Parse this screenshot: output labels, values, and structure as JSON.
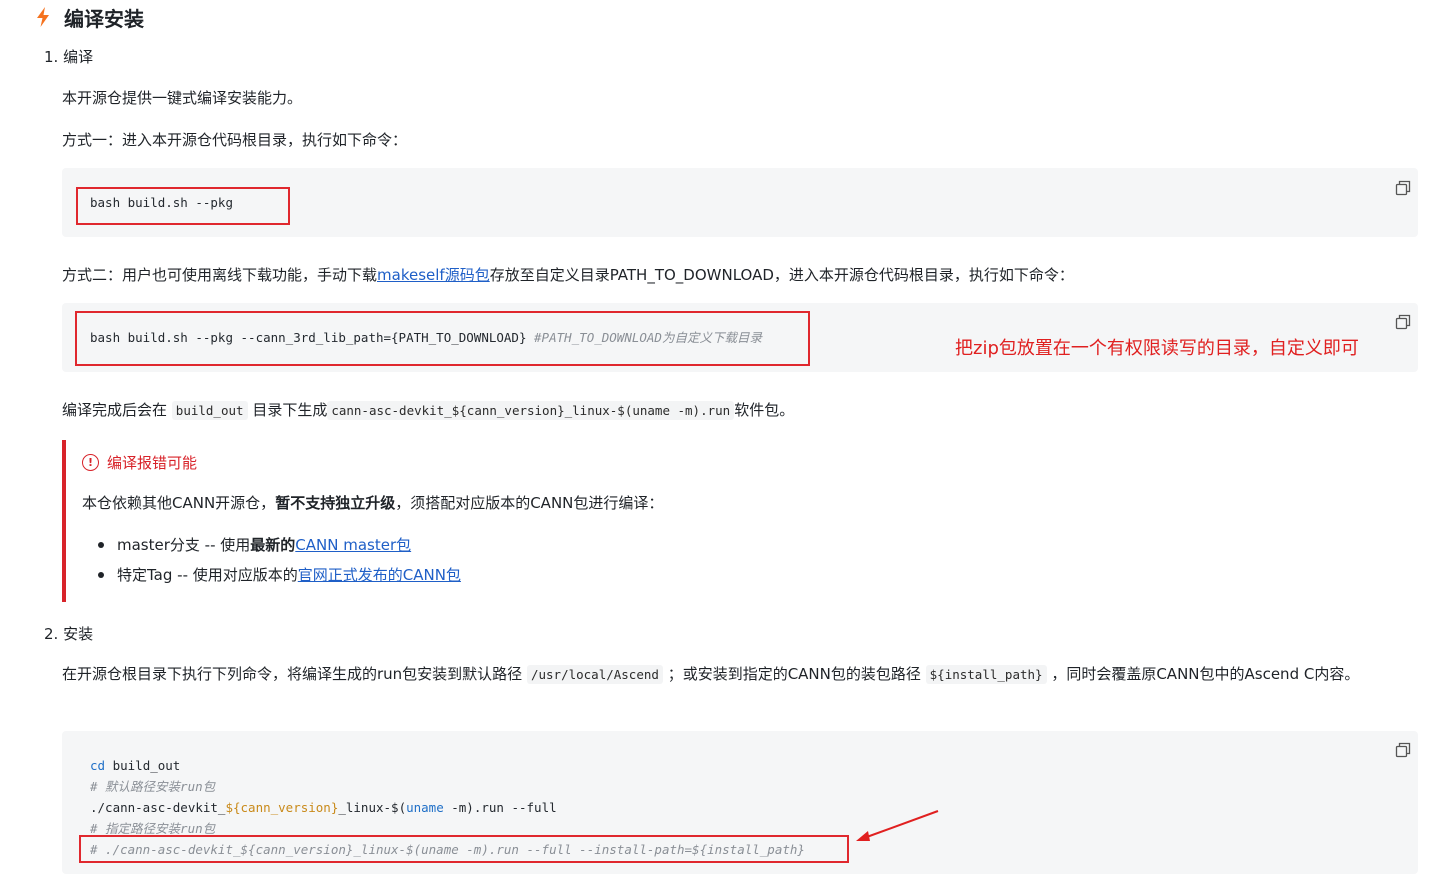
{
  "heading": {
    "title": "编译安装"
  },
  "step1": {
    "number": "1.",
    "label": "编译",
    "intro": "本开源仓提供一键式编译安装能力。",
    "method1": "方式一：进入本开源仓代码根目录，执行如下命令：",
    "code1": "bash build.sh --pkg",
    "method2_pre": "方式二：用户也可使用离线下载功能，手动下载",
    "method2_link": "makeself源码包",
    "method2_post": "存放至自定义目录PATH_TO_DOWNLOAD，进入本开源仓代码根目录，执行如下命令：",
    "code2_cmd": "bash build.sh --pkg --cann_3rd_lib_path={PATH_TO_DOWNLOAD} ",
    "code2_comment": "#PATH_TO_DOWNLOAD为自定义下载目录",
    "annotation": "把zip包放置在一个有权限读写的目录，自定义即可",
    "result_pre": "编译完成后会在",
    "result_code1": "build_out",
    "result_mid": "目录下生成",
    "result_code2": "cann-asc-devkit_${cann_version}_linux-$(uname -m).run",
    "result_post": "软件包。"
  },
  "warning": {
    "title": "编译报错可能",
    "text_pre": "本仓依赖其他CANN开源仓，",
    "text_bold": "暂不支持独立升级",
    "text_post": "，须搭配对应版本的CANN包进行编译：",
    "bullets": [
      {
        "pre": "master分支 -- 使用",
        "bold": "最新的",
        "link": "CANN master包"
      },
      {
        "pre": "特定Tag -- 使用对应版本的",
        "bold": "",
        "link": "官网正式发布的CANN包"
      }
    ]
  },
  "step2": {
    "number": "2.",
    "label": "安装",
    "desc_pre": "在开源仓根目录下执行下列命令，将编译生成的run包安装到默认路径",
    "desc_code1": "/usr/local/Ascend",
    "desc_mid": "；或安装到指定的CANN包的装包路径",
    "desc_code2": "${install_path}",
    "desc_post": "，同时会覆盖原CANN包中的Ascend C内容。",
    "code": {
      "line1_kw": "cd",
      "line1_rest": " build_out",
      "line2": "# 默认路径安装run包",
      "line3_a": "./cann-asc-devkit_",
      "line3_var": "${cann_version}",
      "line3_b": "_linux-$(",
      "line3_kw": "uname",
      "line3_c": " -m).run --full",
      "line4": "# 指定路径安装run包",
      "line5": "# ./cann-asc-devkit_${cann_version}_linux-$(uname -m).run --full --install-path=${install_path}"
    }
  },
  "icons": {
    "heading": "lightning-icon",
    "copy": "copy-icon",
    "warning": "exclamation-circle-icon",
    "arrow": "red-arrow-annotation"
  },
  "colors": {
    "bolt": "#f5731f",
    "link": "#1f5fc7",
    "warning": "#d8232a",
    "annotation": "#e02020",
    "keyword": "#1f6fc7",
    "variable": "#c98a1a",
    "comment": "#8a8f96"
  }
}
